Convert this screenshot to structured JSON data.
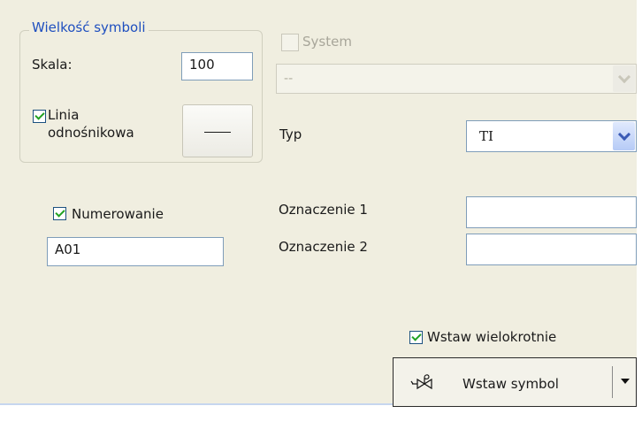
{
  "size_group": {
    "title": "Wielkość symboli",
    "scale_label": "Skala:",
    "scale_value": "100",
    "leader_checkbox_label_line1": "Linia",
    "leader_checkbox_label_line2": "odnośnikowa",
    "leader_checked": true,
    "line_style_button": "line-style-preview"
  },
  "system": {
    "checkbox_label": "System",
    "checked": false,
    "disabled": true,
    "combo_value": "--"
  },
  "type": {
    "label": "Typ",
    "value": "TI"
  },
  "numbering": {
    "checkbox_label": "Numerowanie",
    "checked": true,
    "value": "A01"
  },
  "designation": {
    "label1": "Oznaczenie 1",
    "value1": "",
    "label2": "Oznaczenie 2",
    "value2": ""
  },
  "insert": {
    "multiple_label": "Wstaw wielokrotnie",
    "multiple_checked": true,
    "button_label": "Wstaw symbol",
    "button_icon": "valve-symbol-icon"
  },
  "colors": {
    "panel_bg": "#f0eee0",
    "group_title": "#1f4fbf",
    "checkmark": "#21a121"
  }
}
